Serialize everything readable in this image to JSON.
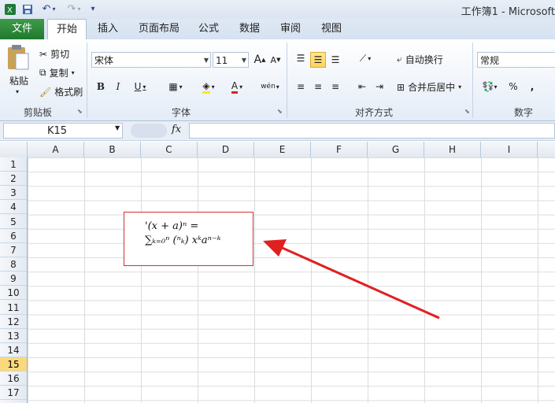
{
  "window": {
    "title": "工作簿1 - Microsoft"
  },
  "tabs": [
    "文件",
    "开始",
    "插入",
    "页面布局",
    "公式",
    "数据",
    "审阅",
    "视图"
  ],
  "clipboard": {
    "paste": "粘贴",
    "cut": "剪切",
    "copy": "复制",
    "format_painter": "格式刷",
    "label": "剪贴板"
  },
  "font": {
    "name": "宋体",
    "size": "11",
    "label": "字体"
  },
  "alignment": {
    "wrap": "自动换行",
    "merge": "合并后居中",
    "label": "对齐方式"
  },
  "number": {
    "format": "常规",
    "percent": "%",
    "comma": ",",
    "label": "数字"
  },
  "formula_bar": {
    "name_box": "K15",
    "fx": "fx"
  },
  "columns": [
    "A",
    "B",
    "C",
    "D",
    "E",
    "F",
    "G",
    "H",
    "I"
  ],
  "rows": [
    "1",
    "2",
    "3",
    "4",
    "5",
    "6",
    "7",
    "8",
    "9",
    "10",
    "11",
    "12",
    "13",
    "14",
    "15",
    "16",
    "17"
  ],
  "selected_row": "15",
  "equation": {
    "line1": "'(x + a)ⁿ =",
    "line2": "∑ₖ₌₀ⁿ (ⁿₖ) xᵏaⁿ⁻ᵏ"
  },
  "colors": {
    "accent_file": "#2e8b3e",
    "arrow": "#e02020",
    "highlight": "#f9d97b"
  }
}
